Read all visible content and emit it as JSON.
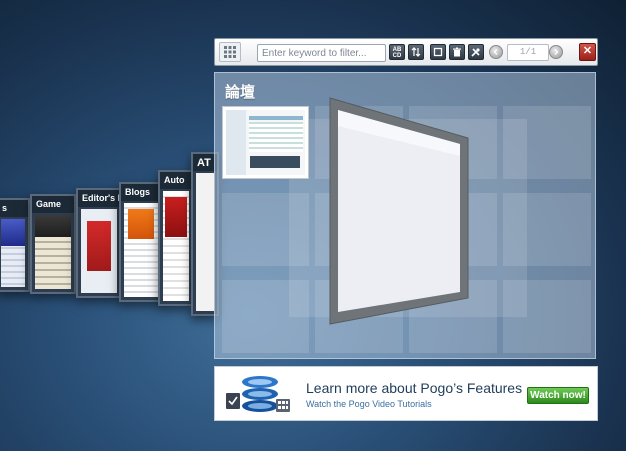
{
  "toolbar": {
    "filter_placeholder": "Enter keyword to filter...",
    "page_indicator": "1/1",
    "close_label": "✕",
    "sort_label": "AB CD",
    "buttons": [
      "grid-view",
      "sort-alpha",
      "sort-numeric",
      "window",
      "trash",
      "tools",
      "prev-page",
      "next-page",
      "close"
    ]
  },
  "group": {
    "title": "論壇",
    "tab_count": 1
  },
  "stack": {
    "cards": [
      {
        "label": "s"
      },
      {
        "label": "Game"
      },
      {
        "label": "Editor's Pi"
      },
      {
        "label": "Blogs"
      },
      {
        "label": "Auto"
      },
      {
        "label": "AT"
      },
      {
        "label": ""
      }
    ]
  },
  "promo": {
    "title": "Learn more about Pogo’s Features",
    "subtitle": "Watch the Pogo Video Tutorials",
    "button_label": "Watch now!"
  },
  "colors": {
    "accent_green": "#2d8a1d",
    "close_red": "#b83228",
    "link_blue": "#3a6fa0",
    "background": "#1a3350"
  }
}
